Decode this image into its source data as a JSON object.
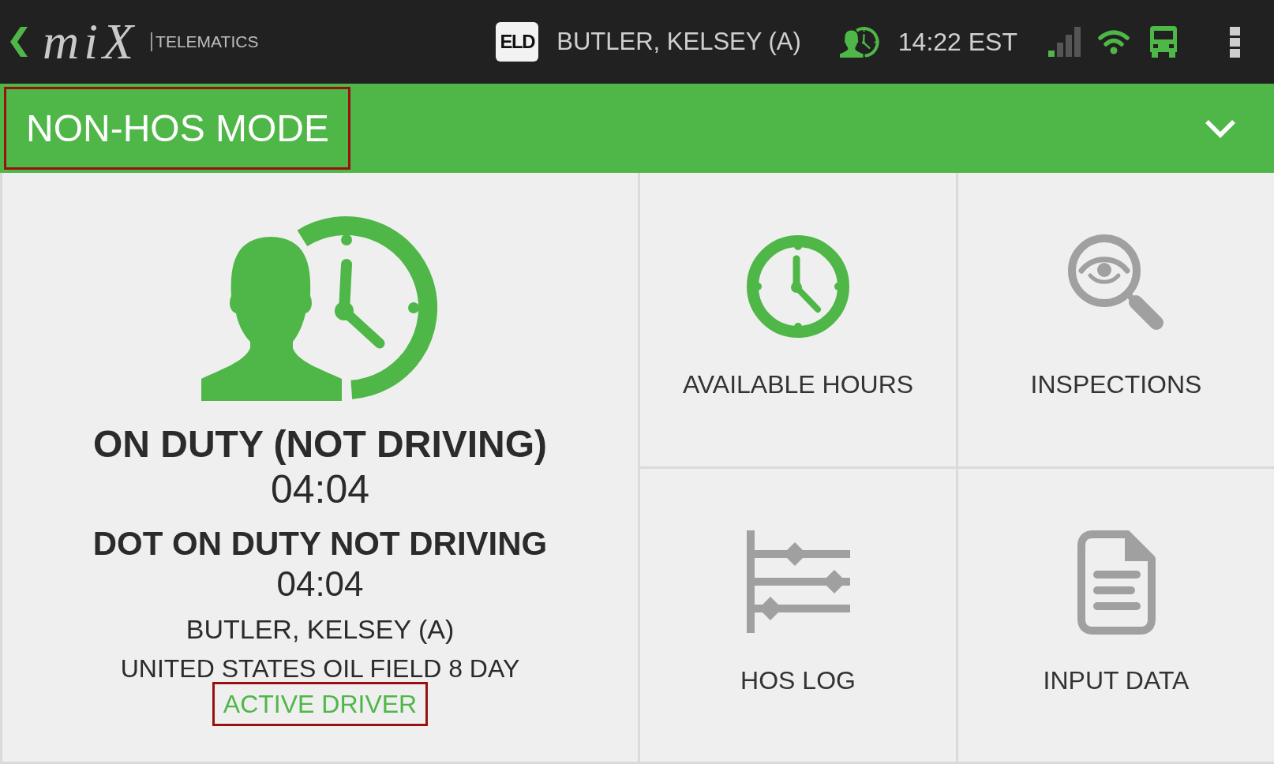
{
  "top_bar": {
    "logo": "miX",
    "logo_subtitle": "TELEMATICS",
    "eld_badge": "ELD",
    "driver_name": "BUTLER, KELSEY (A)",
    "time": "14:22 EST"
  },
  "mode_bar": {
    "title": "NON-HOS MODE",
    "highlighted": true
  },
  "duty_status": {
    "status": "ON DUTY (NOT DRIVING)",
    "status_duration": "04:04",
    "dot_status": "DOT ON DUTY NOT DRIVING",
    "dot_duration": "04:04",
    "driver_name": "BUTLER, KELSEY (A)",
    "ruleset": "UNITED STATES OIL FIELD 8 DAY",
    "driver_role": {
      "text": "ACTIVE DRIVER",
      "highlighted": true
    }
  },
  "tiles": [
    {
      "label": "AVAILABLE HOURS",
      "kind": "clock",
      "color": "#4fb748"
    },
    {
      "label": "INSPECTIONS",
      "kind": "inspection",
      "color": "#a0a0a0"
    },
    {
      "label": "HOS LOG",
      "kind": "log",
      "color": "#a0a0a0"
    },
    {
      "label": "INPUT DATA",
      "kind": "document",
      "color": "#a0a0a0"
    }
  ]
}
